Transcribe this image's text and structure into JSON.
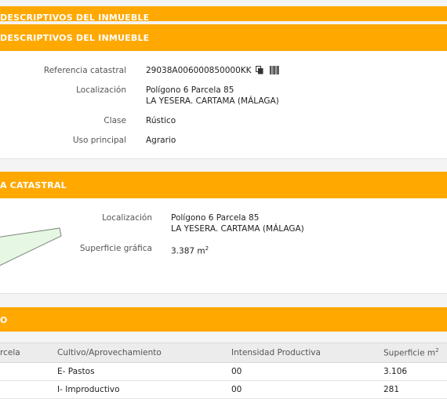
{
  "sections": {
    "top_partial_title": "DESCRIPTIVOS DEL INMUEBLE",
    "descriptivos_title": "DESCRIPTIVOS DEL INMUEBLE",
    "parcela_title": "A CATASTRAL",
    "cultivos_title": "O"
  },
  "descriptivos": {
    "ref_label": "Referencia catastral",
    "ref_value": "29038A006000850000KK",
    "loc_label": "Localización",
    "loc_line1": "Polígono 6 Parcela 85",
    "loc_line2": "LA YESERA. CARTAMA (MÁLAGA)",
    "clase_label": "Clase",
    "clase_value": "Rústico",
    "uso_label": "Uso principal",
    "uso_value": "Agrario"
  },
  "parcela": {
    "loc_label": "Localización",
    "loc_line1": "Polígono 6 Parcela 85",
    "loc_line2": "LA YESERA. CARTAMA (MÁLAGA)",
    "sup_label": "Superficie gráfica",
    "sup_value": "3.387 m",
    "sup_unit_exp": "2"
  },
  "cultivos": {
    "headers": {
      "subparcela": "rcela",
      "cultivo": "Cultivo/Aprovechamiento",
      "intensidad": "Intensidad Productiva",
      "superficie": "Superficie m",
      "superficie_exp": "2"
    },
    "rows": [
      {
        "cultivo": "E- Pastos",
        "intensidad": "00",
        "superficie": "3.106"
      },
      {
        "cultivo": "I- Improductivo",
        "intensidad": "00",
        "superficie": "281"
      }
    ]
  },
  "colors": {
    "accent": "#ffa800",
    "parcel_fill": "#e6f7e4",
    "parcel_stroke": "#7a8a7a"
  },
  "icons": {
    "copy": "copy-icon",
    "barcode": "barcode-icon"
  }
}
